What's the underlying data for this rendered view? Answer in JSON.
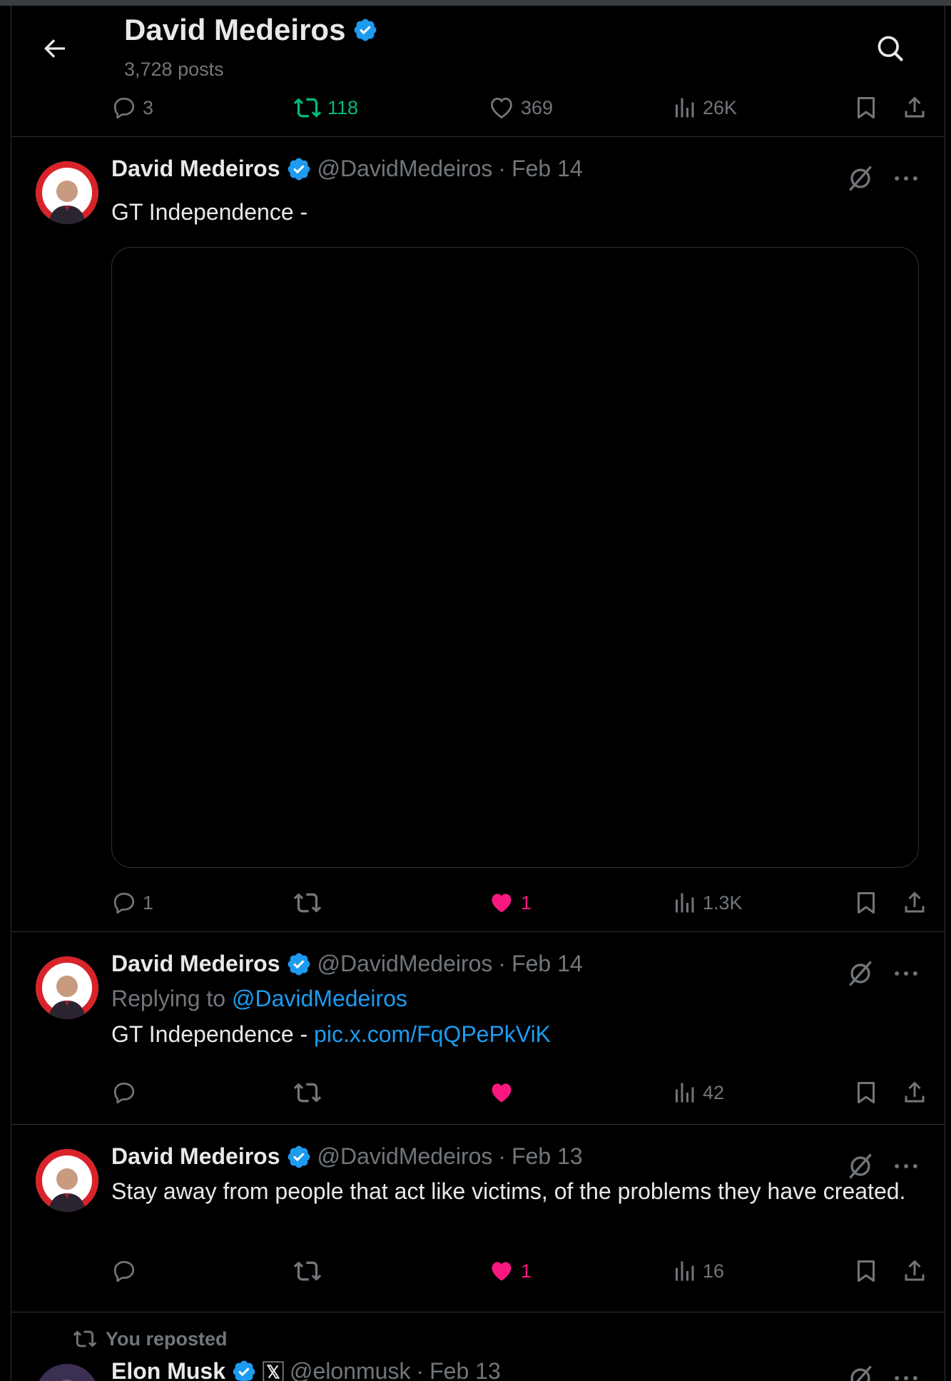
{
  "header": {
    "title": "David Medeiros",
    "posts_count": "3,728 posts"
  },
  "colors": {
    "accent": "#1d9bf0",
    "retweet_green": "#00ba7c",
    "like_pink": "#f91880",
    "muted": "#71767b"
  },
  "prev_post_actions": {
    "replies": "3",
    "reposts": "118",
    "likes": "369",
    "views": "26K"
  },
  "tweets": [
    {
      "name": "David Medeiros",
      "handle": "@DavidMedeiros",
      "dot": "·",
      "date": "Feb 14",
      "text": "GT Independence -",
      "actions": {
        "replies": "1",
        "reposts": "",
        "likes": "1",
        "views": "1.3K"
      }
    },
    {
      "name": "David Medeiros",
      "handle": "@DavidMedeiros",
      "dot": "·",
      "date": "Feb 14",
      "replying_label": "Replying to",
      "replying_handle": "@DavidMedeiros",
      "text": "GT Independence -",
      "link": "pic.x.com/FqQPePkViK",
      "actions": {
        "replies": "",
        "reposts": "",
        "likes": "",
        "views": "42"
      }
    },
    {
      "name": "David Medeiros",
      "handle": "@DavidMedeiros",
      "dot": "·",
      "date": "Feb 13",
      "text": "Stay away from people that act like victims, of the problems they have created.",
      "actions": {
        "replies": "",
        "reposts": "",
        "likes": "1",
        "views": "16"
      }
    }
  ],
  "repost": {
    "label": "You reposted",
    "name": "Elon Musk",
    "handle": "@elonmusk",
    "dot": "·",
    "date": "Feb 13"
  }
}
